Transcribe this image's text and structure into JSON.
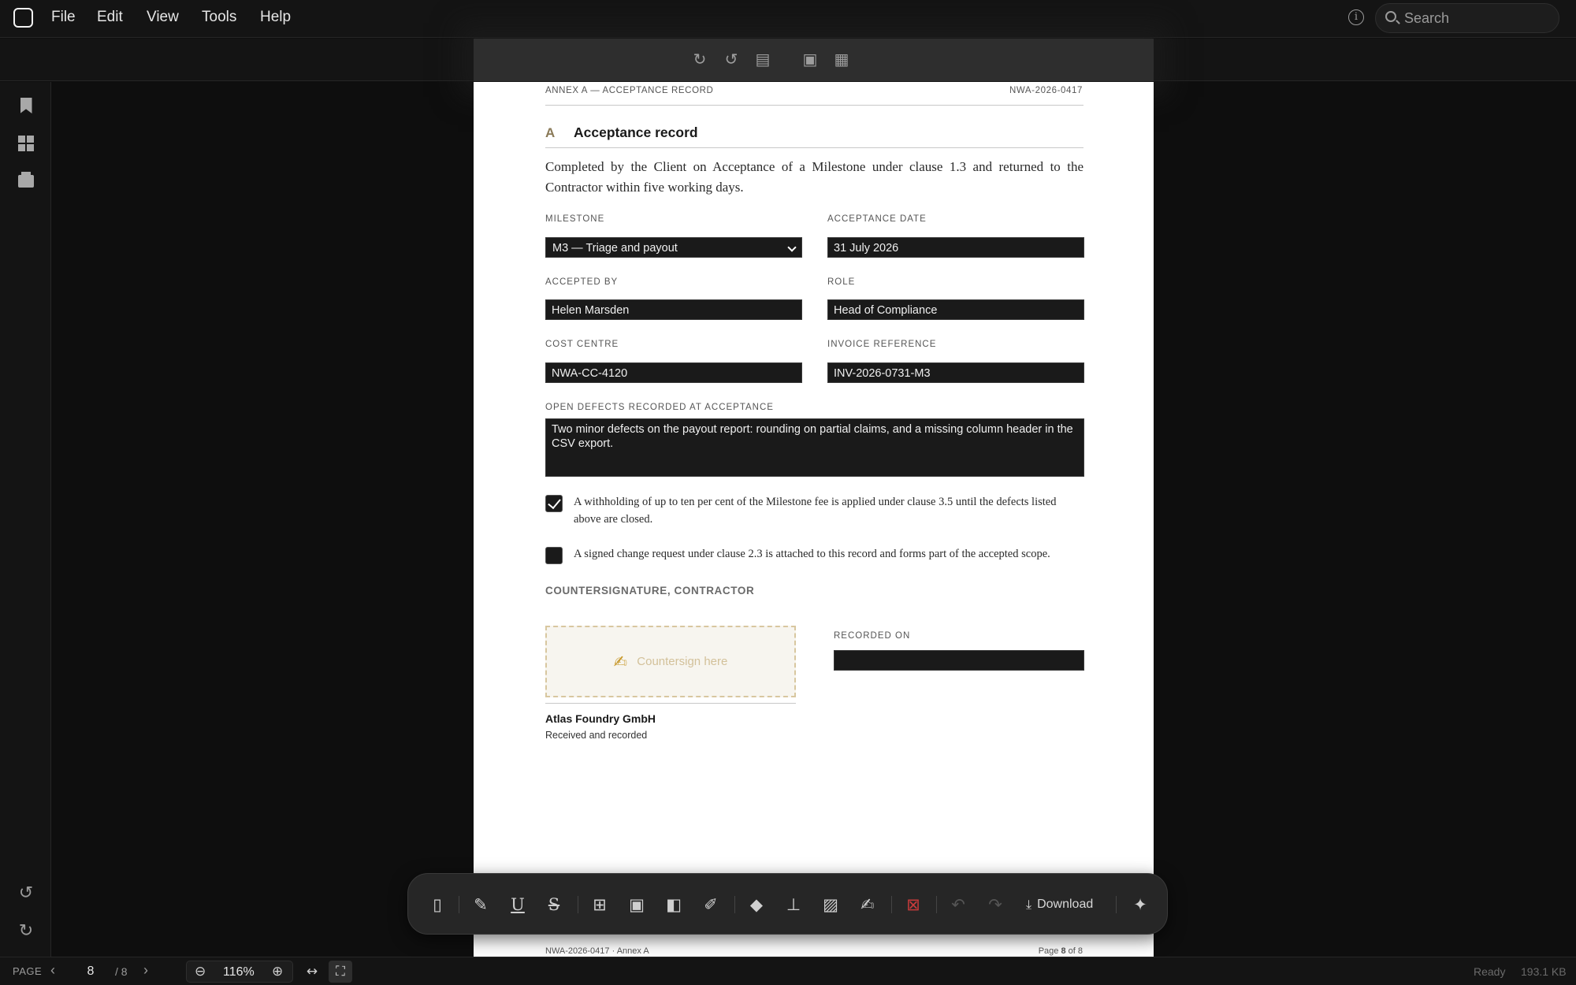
{
  "menu": {
    "file": "File",
    "edit": "Edit",
    "view": "View",
    "tools": "Tools",
    "help": "Help"
  },
  "search": {
    "placeholder": "Search"
  },
  "document": {
    "header_left": "ANNEX A — ACCEPTANCE RECORD",
    "header_right": "NWA-2026-0417",
    "section_letter": "A",
    "section_title": "Acceptance record",
    "intro": "Completed by the Client on Acceptance of a Milestone under clause 1.3 and returned to the Contractor within five working days.",
    "fields": {
      "milestone_label": "MILESTONE",
      "milestone_value": "M3 — Triage and payout",
      "acceptance_date_label": "ACCEPTANCE DATE",
      "acceptance_date_value": "31 July 2026",
      "accepted_by_label": "ACCEPTED BY",
      "accepted_by_value": "Helen Marsden",
      "role_label": "ROLE",
      "role_value": "Head of Compliance",
      "cost_centre_label": "COST CENTRE",
      "cost_centre_value": "NWA-CC-4120",
      "invoice_ref_label": "INVOICE REFERENCE",
      "invoice_ref_value": "INV-2026-0731-M3",
      "defects_label": "OPEN DEFECTS RECORDED AT ACCEPTANCE",
      "defects_value": "Two minor defects on the payout report: rounding on partial claims, and a missing column header in the CSV export."
    },
    "checkboxes": [
      {
        "checked": true,
        "text": "A withholding of up to ten per cent of the Milestone fee is applied under clause 3.5 until the defects listed above are closed."
      },
      {
        "checked": false,
        "text": "A signed change request under clause 2.3 is attached to this record and forms part of the accepted scope."
      }
    ],
    "countersignature": {
      "heading": "COUNTERSIGNATURE, CONTRACTOR",
      "sign_placeholder": "Countersign here",
      "party_name": "Atlas Foundry GmbH",
      "party_note": "Received and recorded",
      "recorded_on_label": "RECORDED ON",
      "recorded_on_value": ""
    },
    "footer_left": "NWA-2026-0417 · Annex A",
    "footer_page_prefix": "Page ",
    "footer_page_num": "8",
    "footer_page_suffix": " of 8"
  },
  "annotation_toolbar": {
    "download_label": "Download"
  },
  "status": {
    "page_label": "PAGE",
    "current_page": "8",
    "total_pages": "/ 8",
    "zoom": "116%",
    "state": "Ready",
    "file_size": "193.1 KB"
  },
  "colors": {
    "accent_letter": "#8a7a58",
    "signature_border": "#d8c79f",
    "redact": "#c63b3b"
  },
  "icons": {
    "menubar": [
      "app-logo-icon",
      "info-icon",
      "search-icon"
    ],
    "left_rail": [
      "bookmark-icon",
      "thumbnails-icon",
      "layers-icon",
      "rotate-ccw-icon",
      "rotate-cw-icon"
    ],
    "page_toolbar": [
      "rotate-cw-icon",
      "rotate-ccw-icon",
      "page-settings-icon",
      "text-recognition-icon",
      "crop-page-icon"
    ],
    "annotation_toolbar": [
      "sidebar-toggle-icon",
      "highlight-icon",
      "underline-icon",
      "strikethrough-icon",
      "text-box-icon",
      "area-select-icon",
      "comment-icon",
      "pen-icon",
      "shapes-icon",
      "stamp-icon",
      "image-icon",
      "signature-icon",
      "redact-icon",
      "undo-icon",
      "redo-icon",
      "download-icon",
      "ai-sparkle-icon"
    ]
  }
}
